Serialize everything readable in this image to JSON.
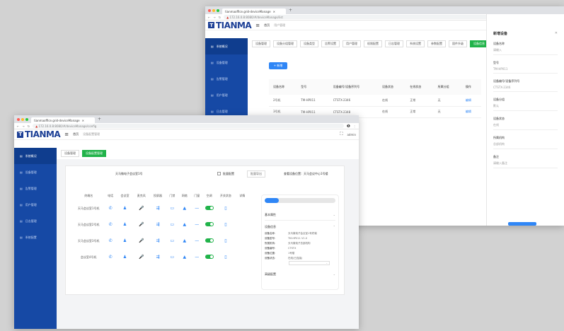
{
  "back_window": {
    "tab_title": "tianmaoffice.grid-deviceManage",
    "url": "172.16.0.8:8080/#/deviceManage/list",
    "app_title": "首页",
    "breadcrumb": "用户管理",
    "side_items": [
      "系统概况",
      "设备管理",
      "告警管理",
      "用户管理",
      "日志管理",
      "系统配置"
    ],
    "page_tabs": [
      "设备管理",
      "设备分组管理",
      "设备类型",
      "告警设置",
      "用户管理",
      "权限配置",
      "日志管理",
      "系统设置",
      "参数配置",
      "固件升级",
      "设备信息"
    ],
    "add_button": "+ 新增",
    "table_headers": [
      "设备名称",
      "型号",
      "设备编号/设备序列号",
      "设备状态",
      "在线状态",
      "所属分组",
      "操作"
    ],
    "rows": [
      [
        "2号机",
        "TM-HP011",
        "CTSTX-2346",
        "在线",
        "正常",
        "无",
        "编辑"
      ],
      [
        "3号机",
        "TM-HP011",
        "CTSTX-2348",
        "在线",
        "正常",
        "无",
        "编辑"
      ]
    ],
    "panel": {
      "title": "新增设备",
      "fields": [
        {
          "label": "设备名称",
          "value": "请输入"
        },
        {
          "label": "型号",
          "value": "TM-HP011"
        },
        {
          "label": "设备编号/设备序列号",
          "value": "CTSTX-2346"
        },
        {
          "label": "设备分组",
          "value": "默认"
        },
        {
          "label": "设备状态",
          "value": "在线"
        },
        {
          "label": "所属机构",
          "value": "总部机构"
        },
        {
          "label": "备注",
          "value": "请输入备注"
        }
      ]
    }
  },
  "front_window": {
    "tab_title": "tianmaoffice.grid-deviceManage",
    "url": "172.16.0.8:8080/#/deviceManage/config",
    "logo": "TIANMA",
    "app_title": "首页",
    "breadcrumb": "设备配置管理",
    "user": "admin",
    "side_items": [
      "系统概况",
      "设备管理",
      "告警管理",
      "用户管理",
      "日志管理",
      "系统配置"
    ],
    "page_tabs": [
      "设备管理",
      "设备配置管理"
    ],
    "meeting_room": "天马微电子会议室1号",
    "filter_button": "批量配置",
    "export_button": "批量导出",
    "device_info": "查看设备位置：天马会议中心1号楼",
    "grid_headers": [
      "终端名",
      "电话",
      "会议室",
      "麦克风",
      "投屏器",
      "门禁",
      "网络",
      "门窗",
      "空调",
      "开关状态",
      "详情"
    ],
    "grid_rows": [
      {
        "name": "天马会议室1号机"
      },
      {
        "name": "天马会议室2号机"
      },
      {
        "name": "天马会议室3号机"
      },
      {
        "name": "会议室4号机"
      }
    ],
    "progress_percent": 20,
    "detail": {
      "section1": "基本属性",
      "section2": "设备信息",
      "rows": [
        {
          "k": "设备名称:",
          "v": "天马微电子会议室1号终端"
        },
        {
          "k": "设备型号:",
          "v": "TM-HP011 V1.0"
        },
        {
          "k": "所属机构:",
          "v": "天马微电子总部机构"
        },
        {
          "k": "设备编号:",
          "v": "CTSTX"
        },
        {
          "k": "设备位置:",
          "v": "1号楼"
        },
        {
          "k": "设备状态:",
          "v": "在线(已连接)"
        }
      ],
      "section3": "高级配置"
    }
  }
}
